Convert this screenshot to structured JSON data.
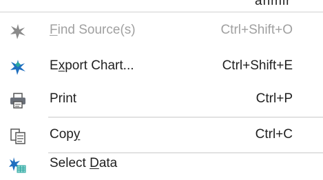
{
  "top_clip_text": "anmir",
  "items": [
    {
      "id": "find-source",
      "pre": "",
      "accel": "F",
      "post": "ind Source(s)",
      "shortcut": "Ctrl+Shift+O",
      "disabled": true,
      "icon": "find-source-icon"
    },
    {
      "id": "export-chart",
      "pre": "E",
      "accel": "x",
      "post": "port Chart...",
      "shortcut": "Ctrl+Shift+E",
      "disabled": false,
      "icon": "export-chart-icon"
    },
    {
      "id": "print",
      "pre": "Print",
      "accel": "",
      "post": "",
      "shortcut": "Ctrl+P",
      "disabled": false,
      "icon": "printer-icon"
    },
    {
      "id": "copy",
      "pre": "Cop",
      "accel": "y",
      "post": "",
      "shortcut": "Ctrl+C",
      "disabled": false,
      "icon": "copy-icon"
    },
    {
      "id": "select-data",
      "pre": "Select ",
      "accel": "D",
      "post": "ata",
      "shortcut": "",
      "disabled": false,
      "icon": "select-data-icon"
    }
  ],
  "colors": {
    "accent_blue": "#1f6fbf",
    "accent_teal": "#2aa7a0",
    "disabled_gray": "#a0a0a0",
    "separator": "#c8c8c8"
  }
}
